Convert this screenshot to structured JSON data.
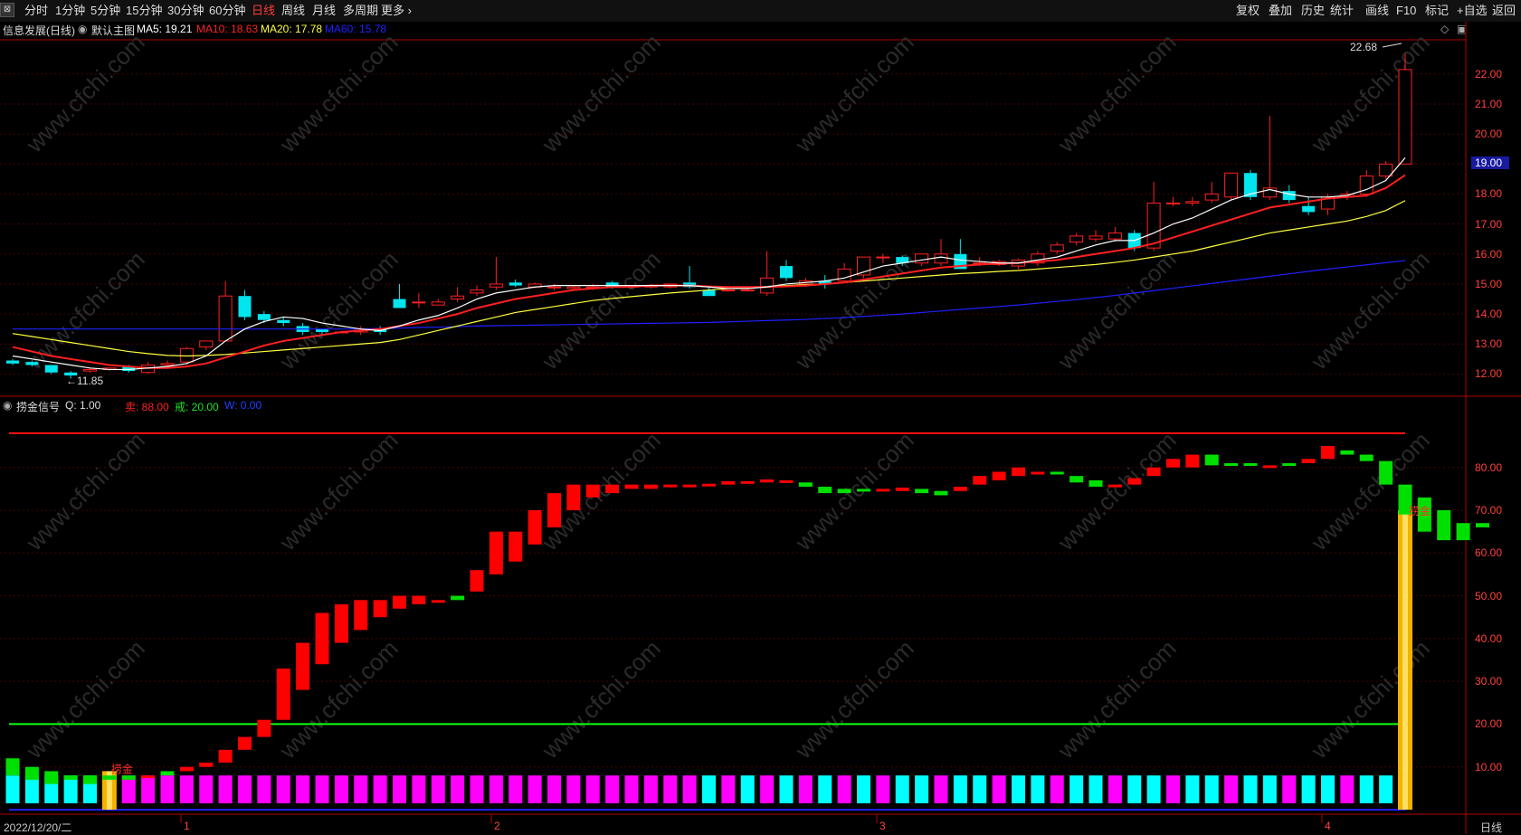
{
  "toolbar": {
    "periods": [
      "分时",
      "1分钟",
      "5分钟",
      "15分钟",
      "30分钟",
      "60分钟",
      "日线",
      "周线",
      "月线",
      "多周期",
      "更多 ›"
    ],
    "active_period": "日线",
    "right_buttons": [
      "复权",
      "叠加",
      "历史",
      "统计",
      "画线",
      "F10",
      "标记",
      "+自选",
      "返回"
    ]
  },
  "main_chart": {
    "stock_title": "信息发展(日线)",
    "template_label": "默认主图",
    "ma": [
      {
        "label": "MA5: 19.21",
        "color": "#ffffff"
      },
      {
        "label": "MA10: 18.63",
        "color": "#ff2020"
      },
      {
        "label": "MA20: 17.78",
        "color": "#ffff40"
      },
      {
        "label": "MA60: 15.78",
        "color": "#2020ff"
      }
    ],
    "price_labels": [
      "22.00",
      "21.00",
      "20.00",
      "18.00",
      "17.00",
      "16.00",
      "15.00",
      "14.00",
      "13.00",
      "12.00"
    ],
    "current_price": "19.00",
    "high_annotation": "22.68",
    "low_annotation": "←11.85"
  },
  "indicator": {
    "name": "捞金信号",
    "q_label": "Q: 1.00",
    "sell_label": "卖: 88.00",
    "warn_label": "戒: 20.00",
    "w_label": "W: 0.00",
    "axis_labels": [
      "80.00",
      "70.00",
      "60.00",
      "50.00",
      "40.00",
      "30.00",
      "20.00",
      "10.00"
    ],
    "signal_text_left": "捞金",
    "signal_text_right": "捞金"
  },
  "xaxis": {
    "start_date": "2022/12/20/二",
    "months": [
      "1",
      "2",
      "3",
      "4"
    ],
    "period_label": "日线"
  },
  "watermark": "www.cfchi.com",
  "colors": {
    "up": "#ff2020",
    "down": "#00e5ee",
    "ma5": "#ffffff",
    "ma10": "#ff2020",
    "ma20": "#ffff40",
    "ma60": "#2020ff",
    "bar_red": "#ff0000",
    "bar_green": "#00e000",
    "magenta": "#ff00ff",
    "cyan": "#00ffff",
    "gold": "#f2b200"
  },
  "chart_data": {
    "type": "candlestick",
    "price_ylim": [
      11.5,
      22.9
    ],
    "candles": [
      [
        12.45,
        12.5,
        12.35,
        12.3
      ],
      [
        12.4,
        12.45,
        12.3,
        12.25
      ],
      [
        12.3,
        12.3,
        12.05,
        12.0
      ],
      [
        12.05,
        12.1,
        11.95,
        11.85
      ],
      [
        12.1,
        12.2,
        12.15,
        12.05
      ],
      [
        12.15,
        12.2,
        12.2,
        12.1
      ],
      [
        12.25,
        12.3,
        12.1,
        12.05
      ],
      [
        12.05,
        12.4,
        12.3,
        12.0
      ],
      [
        12.3,
        12.45,
        12.35,
        12.25
      ],
      [
        12.4,
        12.9,
        12.85,
        12.3
      ],
      [
        12.9,
        13.1,
        13.1,
        12.8
      ],
      [
        13.1,
        15.1,
        14.6,
        13.1
      ],
      [
        14.6,
        14.8,
        13.9,
        13.8
      ],
      [
        14.0,
        14.1,
        13.8,
        13.7
      ],
      [
        13.8,
        13.9,
        13.7,
        13.6
      ],
      [
        13.6,
        13.7,
        13.4,
        13.3
      ],
      [
        13.5,
        13.5,
        13.4,
        13.3
      ],
      [
        13.4,
        13.4,
        13.4,
        13.4
      ],
      [
        13.4,
        13.6,
        13.5,
        13.3
      ],
      [
        13.5,
        13.6,
        13.4,
        13.3
      ],
      [
        14.5,
        15.0,
        14.2,
        14.2
      ],
      [
        14.4,
        14.7,
        14.4,
        14.2
      ],
      [
        14.3,
        14.5,
        14.4,
        14.3
      ],
      [
        14.5,
        14.9,
        14.6,
        14.4
      ],
      [
        14.7,
        14.95,
        14.8,
        14.6
      ],
      [
        14.9,
        15.9,
        15.0,
        14.8
      ],
      [
        15.05,
        15.15,
        14.95,
        14.9
      ],
      [
        14.9,
        15.05,
        15.0,
        14.85
      ],
      [
        14.9,
        15.0,
        14.9,
        14.8
      ],
      [
        14.85,
        14.95,
        14.9,
        14.8
      ],
      [
        14.9,
        15.0,
        14.9,
        14.8
      ],
      [
        15.05,
        15.1,
        14.9,
        14.85
      ],
      [
        14.9,
        14.95,
        14.95,
        14.85
      ],
      [
        14.9,
        15.0,
        14.95,
        14.85
      ],
      [
        14.9,
        15.0,
        15.0,
        14.85
      ],
      [
        15.05,
        15.6,
        14.9,
        14.85
      ],
      [
        14.8,
        14.95,
        14.6,
        14.6
      ],
      [
        14.8,
        14.9,
        14.8,
        14.75
      ],
      [
        14.8,
        14.9,
        14.8,
        14.75
      ],
      [
        14.7,
        16.1,
        15.2,
        14.6
      ],
      [
        15.6,
        15.8,
        15.2,
        15.1
      ],
      [
        15.0,
        15.2,
        15.1,
        14.9
      ],
      [
        15.1,
        15.3,
        15.0,
        14.85
      ],
      [
        15.1,
        15.7,
        15.5,
        15.05
      ],
      [
        15.3,
        15.9,
        15.9,
        15.2
      ],
      [
        15.9,
        16.0,
        15.9,
        15.7
      ],
      [
        15.9,
        15.95,
        15.7,
        15.6
      ],
      [
        15.7,
        15.95,
        16.0,
        15.6
      ],
      [
        15.7,
        16.5,
        16.0,
        15.6
      ],
      [
        16.0,
        16.5,
        15.5,
        15.5
      ],
      [
        15.7,
        15.9,
        15.7,
        15.6
      ],
      [
        15.65,
        15.8,
        15.75,
        15.6
      ],
      [
        15.6,
        15.85,
        15.8,
        15.5
      ],
      [
        15.7,
        16.1,
        16.0,
        15.6
      ],
      [
        16.1,
        16.4,
        16.3,
        16.0
      ],
      [
        16.4,
        16.7,
        16.6,
        16.3
      ],
      [
        16.5,
        16.8,
        16.6,
        16.4
      ],
      [
        16.5,
        16.9,
        16.7,
        16.4
      ],
      [
        16.7,
        16.8,
        16.2,
        16.1
      ],
      [
        16.2,
        18.4,
        17.7,
        16.1
      ],
      [
        17.7,
        17.9,
        17.7,
        17.6
      ],
      [
        17.7,
        17.9,
        17.75,
        17.6
      ],
      [
        17.8,
        18.4,
        18.0,
        17.7
      ],
      [
        17.9,
        18.7,
        18.7,
        17.8
      ],
      [
        18.7,
        18.8,
        17.9,
        17.8
      ],
      [
        17.9,
        20.6,
        18.2,
        17.8
      ],
      [
        18.1,
        18.3,
        17.8,
        17.7
      ],
      [
        17.6,
        17.9,
        17.4,
        17.3
      ],
      [
        17.5,
        18.0,
        17.9,
        17.3
      ],
      [
        17.9,
        18.1,
        18.0,
        17.8
      ],
      [
        18.0,
        18.8,
        18.6,
        17.9
      ],
      [
        18.6,
        19.1,
        19.0,
        18.5
      ],
      [
        19.0,
        22.68,
        22.15,
        19.0
      ]
    ],
    "ma5": [
      12.6,
      12.5,
      12.4,
      12.3,
      12.2,
      12.15,
      12.15,
      12.2,
      12.25,
      12.35,
      12.6,
      13.1,
      13.5,
      13.75,
      13.9,
      13.85,
      13.7,
      13.6,
      13.5,
      13.45,
      13.6,
      13.8,
      13.95,
      14.2,
      14.5,
      14.7,
      14.8,
      14.9,
      14.95,
      14.95,
      14.95,
      14.95,
      14.95,
      14.95,
      14.95,
      14.95,
      14.9,
      14.85,
      14.85,
      14.9,
      15.0,
      15.05,
      15.1,
      15.2,
      15.4,
      15.6,
      15.7,
      15.8,
      15.9,
      15.8,
      15.75,
      15.7,
      15.7,
      15.8,
      15.9,
      16.1,
      16.3,
      16.45,
      16.45,
      16.7,
      17.0,
      17.2,
      17.5,
      17.8,
      18.0,
      18.15,
      18.0,
      17.9,
      17.9,
      17.95,
      18.15,
      18.45,
      19.21
    ],
    "ma10": [
      12.9,
      12.75,
      12.6,
      12.5,
      12.4,
      12.3,
      12.25,
      12.2,
      12.2,
      12.25,
      12.35,
      12.55,
      12.75,
      12.95,
      13.1,
      13.2,
      13.3,
      13.4,
      13.45,
      13.5,
      13.6,
      13.7,
      13.85,
      14.0,
      14.2,
      14.35,
      14.5,
      14.6,
      14.7,
      14.8,
      14.85,
      14.9,
      14.9,
      14.95,
      14.95,
      14.95,
      14.92,
      14.9,
      14.9,
      14.9,
      14.92,
      14.95,
      15.0,
      15.05,
      15.15,
      15.25,
      15.35,
      15.45,
      15.55,
      15.6,
      15.65,
      15.68,
      15.7,
      15.75,
      15.8,
      15.9,
      16.0,
      16.1,
      16.2,
      16.35,
      16.55,
      16.75,
      16.95,
      17.15,
      17.35,
      17.55,
      17.65,
      17.75,
      17.85,
      17.9,
      17.95,
      18.2,
      18.63
    ],
    "ma20": [
      13.35,
      13.25,
      13.15,
      13.05,
      12.95,
      12.85,
      12.75,
      12.68,
      12.62,
      12.6,
      12.62,
      12.65,
      12.7,
      12.75,
      12.8,
      12.85,
      12.9,
      12.95,
      13.0,
      13.05,
      13.15,
      13.3,
      13.45,
      13.6,
      13.75,
      13.9,
      14.05,
      14.15,
      14.25,
      14.35,
      14.45,
      14.52,
      14.58,
      14.64,
      14.7,
      14.75,
      14.8,
      14.85,
      14.88,
      14.92,
      14.95,
      14.98,
      15.0,
      15.05,
      15.1,
      15.15,
      15.2,
      15.25,
      15.3,
      15.35,
      15.38,
      15.42,
      15.45,
      15.5,
      15.55,
      15.6,
      15.65,
      15.72,
      15.8,
      15.9,
      16.0,
      16.1,
      16.25,
      16.4,
      16.55,
      16.7,
      16.8,
      16.9,
      17.0,
      17.1,
      17.25,
      17.45,
      17.78
    ],
    "ma60": [
      13.5,
      13.5,
      13.5,
      13.5,
      13.5,
      13.5,
      13.5,
      13.5,
      13.5,
      13.5,
      13.5,
      13.5,
      13.5,
      13.5,
      13.5,
      13.5,
      13.5,
      13.5,
      13.5,
      13.52,
      13.53,
      13.55,
      13.56,
      13.58,
      13.6,
      13.61,
      13.62,
      13.63,
      13.64,
      13.65,
      13.66,
      13.67,
      13.68,
      13.69,
      13.7,
      13.71,
      13.72,
      13.74,
      13.76,
      13.78,
      13.8,
      13.82,
      13.85,
      13.88,
      13.92,
      13.96,
      14.0,
      14.05,
      14.1,
      14.15,
      14.2,
      14.25,
      14.3,
      14.36,
      14.42,
      14.48,
      14.55,
      14.62,
      14.7,
      14.78,
      14.86,
      14.94,
      15.02,
      15.1,
      15.18,
      15.26,
      15.34,
      15.42,
      15.5,
      15.57,
      15.64,
      15.71,
      15.78
    ],
    "indicator_ylim": [
      0,
      92
    ],
    "indicator_bars": [
      [
        12,
        8
      ],
      [
        10,
        7
      ],
      [
        9,
        6
      ],
      [
        8,
        7
      ],
      [
        8,
        6
      ],
      [
        8,
        7
      ],
      [
        8,
        7
      ],
      [
        8,
        8
      ],
      [
        9,
        8
      ],
      [
        9,
        10
      ],
      [
        10,
        11
      ],
      [
        11,
        14
      ],
      [
        14,
        17
      ],
      [
        17,
        21
      ],
      [
        21,
        33
      ],
      [
        28,
        39
      ],
      [
        34,
        46
      ],
      [
        39,
        48
      ],
      [
        42,
        49
      ],
      [
        45,
        49
      ],
      [
        47,
        50
      ],
      [
        48,
        50
      ],
      [
        49,
        49
      ],
      [
        50,
        49
      ],
      [
        51,
        56
      ],
      [
        55,
        65
      ],
      [
        58,
        65
      ],
      [
        62,
        70
      ],
      [
        66,
        74
      ],
      [
        70,
        76
      ],
      [
        73,
        76
      ],
      [
        74,
        76
      ],
      [
        75,
        76
      ],
      [
        75,
        76
      ],
      [
        75.5,
        76
      ],
      [
        75.5,
        76
      ],
      [
        75.8,
        76.2
      ],
      [
        76,
        76.8
      ],
      [
        76.3,
        76.8
      ],
      [
        76.5,
        77.2
      ],
      [
        76.5,
        77
      ],
      [
        76.5,
        75.5
      ],
      [
        75.5,
        74
      ],
      [
        75,
        74
      ],
      [
        75,
        74.5
      ],
      [
        74.5,
        75
      ],
      [
        74.5,
        75.3
      ],
      [
        75,
        74
      ],
      [
        74.5,
        73.5
      ],
      [
        74.5,
        75.5
      ],
      [
        76,
        78
      ],
      [
        77,
        79
      ],
      [
        78,
        80
      ],
      [
        79,
        79
      ],
      [
        79,
        78.5
      ],
      [
        78,
        76.5
      ],
      [
        77,
        75.5
      ],
      [
        76,
        76
      ],
      [
        76,
        77.5
      ],
      [
        78,
        80
      ],
      [
        80,
        82
      ],
      [
        80,
        83
      ],
      [
        83,
        80.5
      ],
      [
        81,
        80.5
      ],
      [
        81,
        80.5
      ],
      [
        80.5,
        80.5
      ],
      [
        81,
        80.5
      ],
      [
        81,
        82
      ],
      [
        82,
        85
      ],
      [
        84,
        83
      ],
      [
        83,
        81.5
      ],
      [
        81.5,
        76
      ],
      [
        76,
        69
      ],
      [
        73,
        65
      ],
      [
        70,
        63
      ],
      [
        67,
        63
      ],
      [
        67,
        66
      ]
    ],
    "sell_level": 88,
    "warn_level": 20
  }
}
